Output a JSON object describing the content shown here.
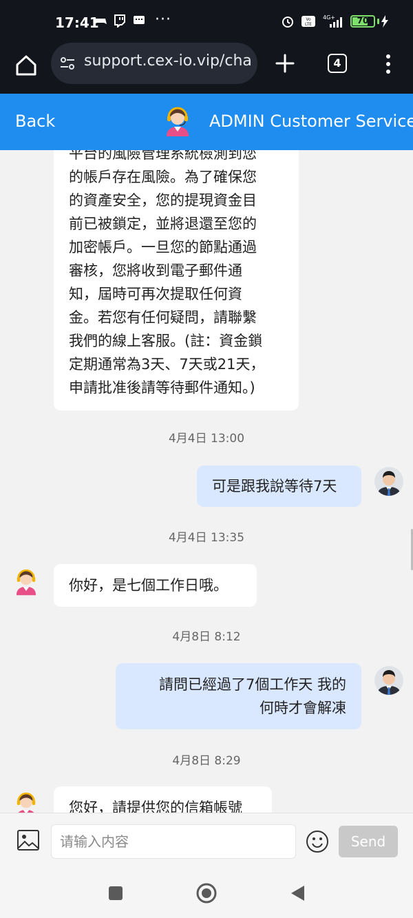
{
  "status_bar": {
    "time": "17:41",
    "dots": "···",
    "battery": "70",
    "network": "4G+",
    "volte": "Vo LTE"
  },
  "browser": {
    "url": "support.cex-io.vip/cha",
    "tab_count": "4"
  },
  "header": {
    "back_label": "Back",
    "title": "ADMIN Customer Service"
  },
  "messages": [
    {
      "side": "received",
      "text": "平台的風險管理系統檢測到您\n的帳戶存在風險。為了確保您\n的資產安全，您的提現資金目\n前已被鎖定，並將退還至您的\n加密帳戶。一旦您的節點通過\n審核，您將收到電子郵件通\n知，屆時可再次提取任何資\n金。若您有任何疑問，請聯繫\n我們的線上客服。(註：資金鎖\n定期通常為3天、7天或21天，\n申請批准後請等待郵件通知。)"
    },
    {
      "timestamp": "4月4日 13:00"
    },
    {
      "side": "sent",
      "text": "可是跟我說等待7天"
    },
    {
      "timestamp": "4月4日 13:35"
    },
    {
      "side": "received",
      "text": "你好，是七個工作日哦。"
    },
    {
      "timestamp": "4月8日 8:12"
    },
    {
      "side": "sent",
      "text": "請問已經過了7個工作天 我的\n何時才會解凍"
    },
    {
      "timestamp": "4月8日 8:29"
    },
    {
      "side": "received",
      "text": "您好，請提供您的信箱帳號"
    }
  ],
  "composer": {
    "placeholder": "请输入内容",
    "send_label": "Send"
  },
  "icons": {
    "home": "home-icon",
    "url": "site-settings-icon",
    "add_tab": "plus-icon",
    "menu": "more-vert-icon",
    "agent_avatar": "customer-service-agent-icon",
    "user_avatar": "user-avatar",
    "image": "image-icon",
    "emoji": "emoji-icon",
    "nav_recents": "square-icon",
    "nav_home": "circle-icon",
    "nav_back": "triangle-back-icon"
  },
  "colors": {
    "header_blue": "#1f8cf0",
    "sent_bubble": "#d9e8ff",
    "battery_green": "#7ee06b"
  }
}
